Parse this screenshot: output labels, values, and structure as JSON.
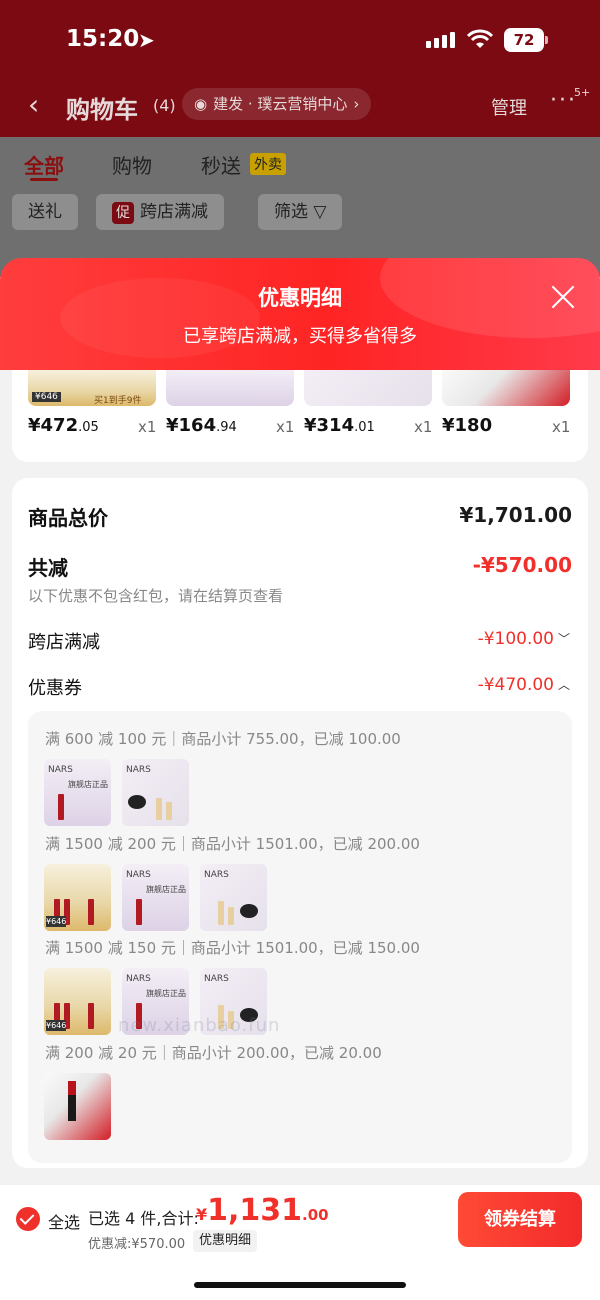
{
  "status_bar": {
    "time": "15:20",
    "battery": "72"
  },
  "nav": {
    "back_glyph": "‹",
    "title": "购物车",
    "count": "(4)",
    "address": "建发 · 璞云营销中心",
    "address_arrow": "›",
    "manage": "管理",
    "more": "···",
    "more_badge": "5+"
  },
  "tabs": [
    {
      "label": "全部",
      "active": true
    },
    {
      "label": "购物"
    },
    {
      "label": "秒送",
      "tag": "外卖"
    }
  ],
  "chips": {
    "gift": "送礼",
    "promo_tag": "促",
    "promo": "跨店满减",
    "filter": "筛选"
  },
  "sheet": {
    "title": "优惠明细",
    "subtitle": "已享跨店满减，买得多省得多"
  },
  "products": [
    {
      "price_int": "¥472",
      "price_dec": ".05",
      "qty": "x1",
      "thumb": "gold"
    },
    {
      "price_int": "¥164",
      "price_dec": ".94",
      "qty": "x1",
      "thumb": "lilac"
    },
    {
      "price_int": "¥314",
      "price_dec": ".01",
      "qty": "x1",
      "thumb": "dark"
    },
    {
      "price_int": "¥180",
      "price_dec": "",
      "qty": "x1",
      "thumb": "red"
    }
  ],
  "summary": {
    "total_label": "商品总价",
    "total_value": "¥1,701.00",
    "reduce_label": "共减",
    "reduce_value": "-¥570.00",
    "reduce_hint": "以下优惠不包含红包，请在结算页查看",
    "cross_label": "跨店满减",
    "cross_value": "-¥100.00",
    "cross_chevron": "﹀",
    "coupon_label": "优惠券",
    "coupon_value": "-¥470.00",
    "coupon_chevron": "︿"
  },
  "coupons": [
    {
      "text": "满 600 减 100 元｜商品小计 755.00，已减 100.00",
      "thumbs": [
        "lilac",
        "dark"
      ]
    },
    {
      "text": "满 1500 减 200 元｜商品小计 1501.00，已减 200.00",
      "thumbs": [
        "gold",
        "lilac",
        "dark"
      ]
    },
    {
      "text": "满 1500 减 150 元｜商品小计 1501.00，已减 150.00",
      "thumbs": [
        "gold",
        "lilac",
        "dark"
      ]
    },
    {
      "text": "满 200 减 20 元｜商品小计 200.00，已减 20.00",
      "thumbs": [
        "red"
      ]
    }
  ],
  "thumb_text": {
    "nars": "NARS",
    "flagship": "旗舰店正品",
    "gold_price": "¥646",
    "gold_label": "买1到手9件"
  },
  "footer": {
    "select_all": "全选",
    "selected": "已选 4 件,合计:",
    "currency": "¥",
    "total_int": "1,131",
    "total_dec": ".00",
    "discount": "优惠减:¥570.00",
    "detail": "优惠明细",
    "pay": "领券结算"
  },
  "watermark": "new.xianbao.fun",
  "colors": {
    "accent": "#f0302a",
    "header_red": "#7c0a12"
  }
}
